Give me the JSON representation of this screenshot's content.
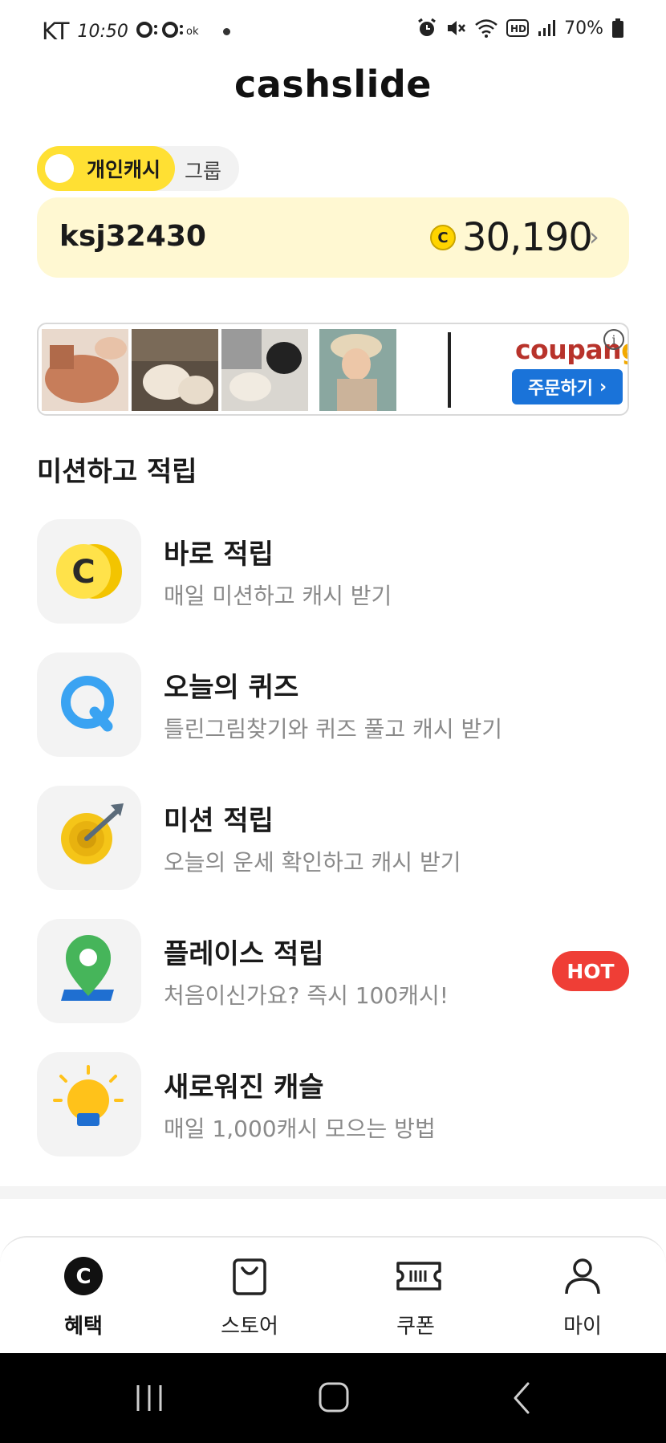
{
  "status_bar": {
    "carrier": "KT",
    "time": "10:50",
    "battery": "70%",
    "status_icons": [
      "alarm-icon",
      "mute-icon",
      "wifi-icon",
      "hd-icon",
      "signal-icon",
      "battery-icon"
    ]
  },
  "app": {
    "title": "cashslide"
  },
  "toggle": {
    "active_label": "개인캐시",
    "inactive_label": "그룹"
  },
  "cash_card": {
    "username": "ksj32430",
    "coin_symbol": "C",
    "amount": "30,190"
  },
  "ad": {
    "brand_main": "coupan",
    "brand_tail": "g",
    "cta_label": "주문하기",
    "info_symbol": "i"
  },
  "section": {
    "title": "미션하고 적립"
  },
  "missions": [
    {
      "title": "바로 적립",
      "subtitle": "매일 미션하고 캐시 받기",
      "icon": "coin-icon"
    },
    {
      "title": "오늘의 퀴즈",
      "subtitle": "틀린그림찾기와 퀴즈 풀고 캐시 받기",
      "icon": "quiz-icon"
    },
    {
      "title": "미션 적립",
      "subtitle": "오늘의 운세 확인하고 캐시 받기",
      "icon": "target-icon"
    },
    {
      "title": "플레이스 적립",
      "subtitle": "처음이신가요? 즉시 100캐시!",
      "icon": "location-pin-icon",
      "badge": "HOT"
    },
    {
      "title": "새로워진 캐슬",
      "subtitle": "매일 1,000캐시 모으는 방법",
      "icon": "lightbulb-icon"
    }
  ],
  "bottom_nav": [
    {
      "label": "혜택",
      "icon": "benefit-icon",
      "active": true
    },
    {
      "label": "스토어",
      "icon": "shopping-bag-icon",
      "active": false
    },
    {
      "label": "쿠폰",
      "icon": "ticket-icon",
      "active": false
    },
    {
      "label": "마이",
      "icon": "user-icon",
      "active": false
    }
  ],
  "colors": {
    "accent_yellow": "#ffe033",
    "card_bg": "#fff8d2",
    "hot_red": "#ef3e36",
    "cta_blue": "#1a73d9"
  }
}
